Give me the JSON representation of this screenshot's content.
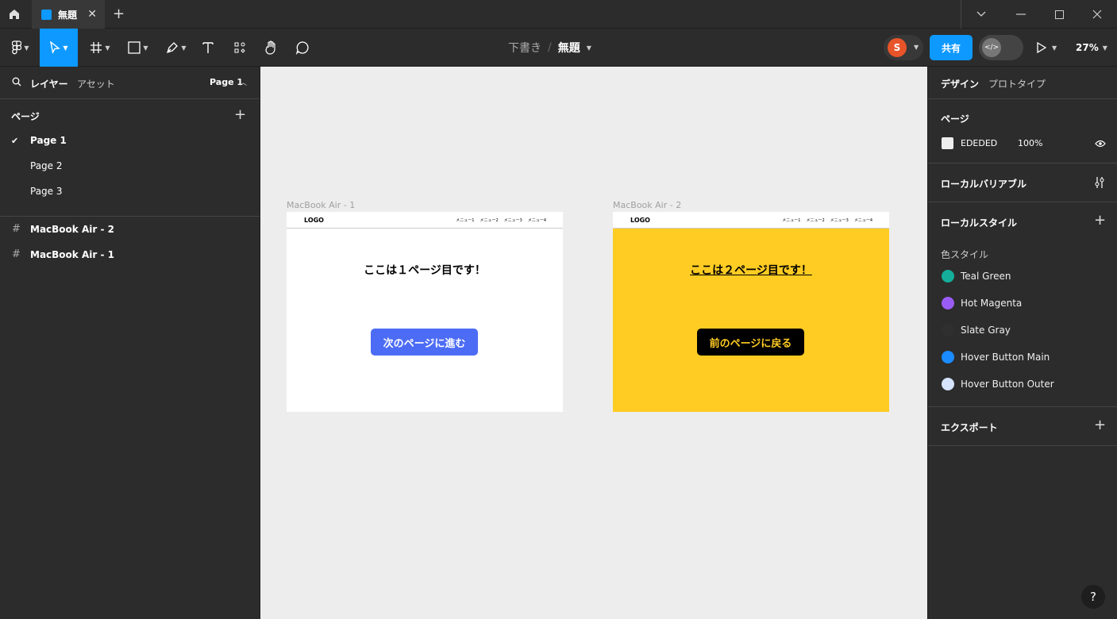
{
  "titlebar": {
    "tab_label": "無題",
    "new_tab": "+"
  },
  "toolbar": {
    "breadcrumb_draft": "下書き",
    "breadcrumb_sep": "/",
    "file_name": "無題",
    "avatar_initial": "S",
    "share_label": "共有",
    "zoom": "27%"
  },
  "left_panel": {
    "tab_layers": "レイヤー",
    "tab_assets": "アセット",
    "page_selector": "Page 1",
    "pages_heading": "ページ",
    "pages": [
      "Page 1",
      "Page 2",
      "Page 3"
    ],
    "layers": [
      "MacBook Air - 2",
      "MacBook Air - 1"
    ]
  },
  "canvas": {
    "background": "#EDEDED",
    "frames": [
      {
        "label": "MacBook Air - 1",
        "logo": "LOGO",
        "menus": [
          "メニュー1",
          "メニュー2",
          "メニュー3",
          "メニュー4"
        ],
        "heading": "ここは１ページ目です！",
        "button": "次のページに進む",
        "bg": "#FFFFFF",
        "button_bg": "#4D6CF5",
        "button_color": "#FFFFFF"
      },
      {
        "label": "MacBook Air - 2",
        "logo": "LOGO",
        "menus": [
          "メニュー1",
          "メニュー2",
          "メニュー3",
          "メニュー4"
        ],
        "heading": "ここは２ページ目です！",
        "button": "前のページに戻る",
        "bg": "#FFCC23",
        "button_bg": "#000000",
        "button_color": "#FFCC23"
      }
    ]
  },
  "right_panel": {
    "tab_design": "デザイン",
    "tab_prototype": "プロトタイプ",
    "page_heading": "ページ",
    "page_color_hex": "EDEDED",
    "page_color_opacity": "100%",
    "local_variables": "ローカルバリアブル",
    "local_styles": "ローカルスタイル",
    "color_styles_heading": "色スタイル",
    "color_styles": [
      {
        "name": "Teal Green",
        "color": "#14AE9B"
      },
      {
        "name": "Hot Magenta",
        "color": "#9B5CF5"
      },
      {
        "name": "Slate Gray",
        "color": "#2F2F2F"
      },
      {
        "name": "Hover Button Main",
        "color": "#1A8CFF"
      },
      {
        "name": "Hover Button Outer",
        "color": "#D6E4FF"
      }
    ],
    "export": "エクスポート"
  },
  "help": "?"
}
